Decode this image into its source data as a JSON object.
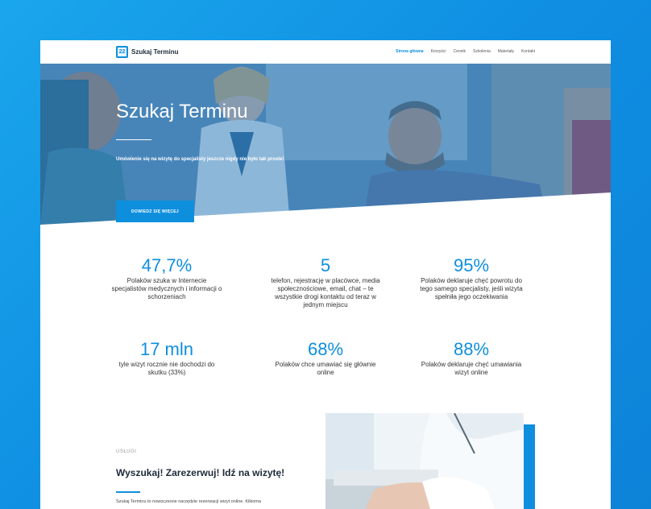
{
  "header": {
    "logo_number": "22",
    "logo_text": "Szukaj Terminu",
    "nav": [
      "Strona główna",
      "Korzyści",
      "Cennik",
      "Szkolenia",
      "Materiały",
      "Kontakt"
    ]
  },
  "hero": {
    "title": "Szukaj Terminu",
    "subtitle": "Umówienie się na wizytę do specjalisty jeszcze nigdy nie było tak proste!",
    "button": "DOWIEDZ SIĘ WIĘCEJ"
  },
  "stats": [
    {
      "number": "47,7%",
      "desc": [
        "Polaków szuka w Internecie",
        "specjalistów medycznych i informacji o",
        "schorzeniach"
      ]
    },
    {
      "number": "5",
      "desc": [
        "telefon, rejestrację w placówce, media",
        "społecznościowe, email, chat – te",
        "wszystkie drogi kontaktu od teraz w",
        "jednym miejscu"
      ]
    },
    {
      "number": "95%",
      "desc": [
        "Polaków deklaruje chęć powrotu do",
        "tego samego specjalisty, jeśli wizyta",
        "spełniła jego oczekiwania"
      ]
    },
    {
      "number": "17 mln",
      "desc": [
        "tyle wizyt rocznie nie dochodzi do",
        "skutku (33%)"
      ]
    },
    {
      "number": "68%",
      "desc": [
        "Polaków chce umawiać się głównie",
        "online"
      ]
    },
    {
      "number": "88%",
      "desc": [
        "Polaków deklaruje chęć umawiania",
        "wizyt online"
      ]
    }
  ],
  "services": {
    "label": "USŁUGI",
    "title": "Wyszukaj! Zarezerwuj! Idź na wizytę!",
    "text": "Szukaj Terminu to nowoczesne narzędzie rezerwacji wizyt online. Kilkoma"
  },
  "colors": {
    "accent": "#0e8fdd",
    "background": "#1298e4"
  }
}
